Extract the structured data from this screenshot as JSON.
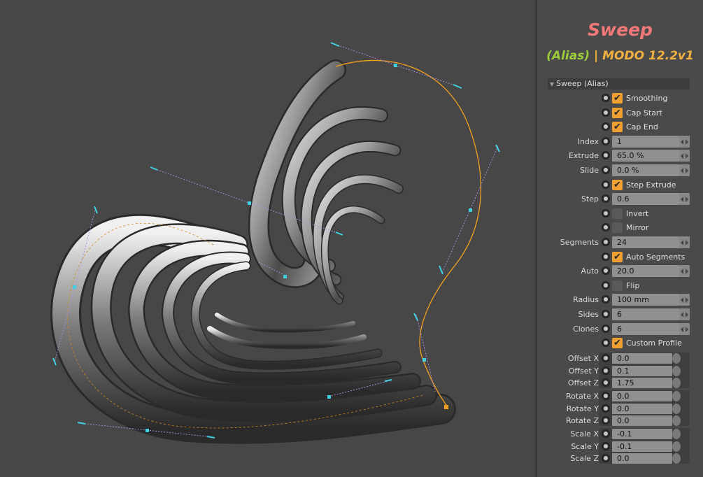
{
  "panel": {
    "title": "Sweep",
    "subtitle_alias": "(Alias)",
    "subtitle_rest": " | MODO 12.2v1",
    "group_label": "Sweep (Alias)"
  },
  "properties": [
    {
      "type": "check",
      "label": "Smoothing",
      "checked": true
    },
    {
      "type": "check",
      "label": "Cap Start",
      "checked": true
    },
    {
      "type": "check",
      "label": "Cap End",
      "checked": true
    },
    {
      "type": "field",
      "label": "Index",
      "value": "1"
    },
    {
      "type": "field",
      "label": "Extrude",
      "value": "65.0 %"
    },
    {
      "type": "field",
      "label": "Slide",
      "value": "0.0 %"
    },
    {
      "type": "check",
      "label": "Step Extrude",
      "checked": true
    },
    {
      "type": "field",
      "label": "Step",
      "value": "0.6"
    },
    {
      "type": "check",
      "label": "Invert",
      "checked": false
    },
    {
      "type": "check",
      "label": "Mirror",
      "checked": false
    },
    {
      "type": "field",
      "label": "Segments",
      "value": "24"
    },
    {
      "type": "check",
      "label": "Auto Segments",
      "checked": true
    },
    {
      "type": "field",
      "label": "Auto",
      "value": "20.0"
    },
    {
      "type": "check",
      "label": "Flip",
      "checked": false
    },
    {
      "type": "field",
      "label": "Radius",
      "value": "100 mm"
    },
    {
      "type": "field",
      "label": "Sides",
      "value": "6"
    },
    {
      "type": "field",
      "label": "Clones",
      "value": "6"
    },
    {
      "type": "check",
      "label": "Custom Profile",
      "checked": true
    }
  ],
  "vectors": [
    {
      "name": "offset",
      "rows": [
        {
          "label": "Offset X",
          "value": "0.0"
        },
        {
          "label": "Offset Y",
          "value": "0.1"
        },
        {
          "label": "Offset Z",
          "value": "1.75"
        }
      ]
    },
    {
      "name": "rotate",
      "rows": [
        {
          "label": "Rotate X",
          "value": "0.0"
        },
        {
          "label": "Rotate Y",
          "value": "0.0"
        },
        {
          "label": "Rotate Z",
          "value": "0.0"
        }
      ]
    },
    {
      "name": "scale",
      "rows": [
        {
          "label": "Scale X",
          "value": "-0.1"
        },
        {
          "label": "Scale Y",
          "value": "-0.1"
        },
        {
          "label": "Scale Z",
          "value": "0.0"
        }
      ]
    }
  ],
  "colors": {
    "title": "#f07878",
    "alias": "#9ccc3c",
    "version": "#f0b040",
    "checkbox_on": "#f0a030",
    "curve": "#f0a020",
    "handle": "#40d0e0"
  },
  "icons": {
    "check": "✔",
    "group_toggle": "triangle-down-icon"
  }
}
